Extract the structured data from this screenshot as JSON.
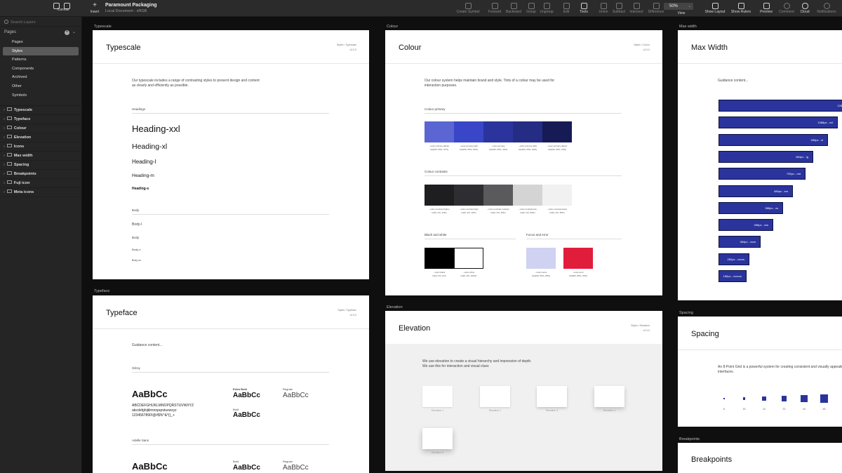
{
  "toolbar": {
    "canvas_label": "Canvas",
    "insert_label": "Insert",
    "doc_title": "Paramount Packaging",
    "doc_subtitle": "Local Document - sRGB",
    "create_symbol": "Create Symbol",
    "forward": "Forward",
    "backward": "Backward",
    "group": "Group",
    "ungroup": "Ungroup",
    "edit": "Edit",
    "tools": "Tools",
    "union": "Union",
    "subtract": "Subtract",
    "intersect": "Intersect",
    "difference": "Difference",
    "zoom_value": "50%",
    "view": "View",
    "show_layout": "Show Layout",
    "show_rulers": "Show Rulers",
    "preview": "Preview",
    "comment": "Comment",
    "cloud": "Cloud",
    "notifications": "Notifications"
  },
  "sidebar": {
    "search_placeholder": "Search Layers",
    "pages_header": "Pages",
    "pages": [
      "Pages",
      "Styles",
      "Patterns",
      "Components",
      "Archived",
      "Other",
      "Symbols"
    ],
    "selected_page": "Styles",
    "layers": [
      "Typescale",
      "Typeface",
      "Colour",
      "Elevation",
      "Icons",
      "Max width",
      "Spacing",
      "Breakpoints",
      "Fuji icon",
      "Meta icons"
    ]
  },
  "canvas": {
    "typescale": {
      "label": "Typescale",
      "title": "Typescale",
      "meta1": "Styles / Typescale",
      "meta2": "v2.0.0",
      "intro": "Our typescale includes a range of contrasting styles to present design and content as clearly and efficiently as possible.",
      "headings_label": "Headings",
      "headings": [
        "Heading-xxl",
        "Heading-xl",
        "Heading-l",
        "Heading-m",
        "Heading-s"
      ],
      "body_label": "Body",
      "body": [
        "Body-l",
        "Body",
        "Body-s",
        "Body-xs"
      ]
    },
    "typeface": {
      "label": "Typeface",
      "title": "Typeface",
      "meta1": "Styles / Typeface",
      "meta2": "v2.0.0",
      "guidance": "Guidance content...",
      "font1": "Gilroy",
      "sample": "AaBbCc",
      "alpha_upper": "ABCDEFGHIJKLMNOPQRSTUVWXYZ",
      "alpha_lower": "abcdefghijklmnopqrstuvwxyz",
      "alpha_nums": "1234567890!@#$%^&*()_+",
      "w_extra_bold": "Extra Bold",
      "w_regular": "Regular",
      "w_bold": "Bold",
      "font2": "Adelle Sans",
      "w_bold2": "Bold",
      "w_regular2": "Regular"
    },
    "colour": {
      "label": "Colour",
      "title": "Colour",
      "meta1": "Styles / Colour",
      "meta2": "v2.0.0",
      "intro": "Our colour system helps maintain brand and style. Tints of a colour may be used for interaction purposes.",
      "primary_label": "Colour primary",
      "primary": [
        {
          "name": "--color-primary-lighter",
          "value": "hsl(236, 55%, 57%)",
          "hex": "#5b66d2"
        },
        {
          "name": "--color-primary-light",
          "value": "hsl(236, 55%, 52%)",
          "hex": "#3a46c8"
        },
        {
          "name": "--color-primary",
          "value": "hsl(236, 55%, 43%)",
          "hex": "#2a349c"
        },
        {
          "name": "--color-primary-dark",
          "value": "hsl(236, 55%, 40%)",
          "hex": "#242c84"
        },
        {
          "name": "--color-primary-darker",
          "value": "hsl(236, 55%, 25%)",
          "hex": "#161b55"
        }
      ],
      "contrast_label": "Colour contrasts",
      "contrast": [
        {
          "name": "--color-contrast-higher",
          "value": "hsl(0, 0%, 13%)",
          "hex": "#1e1e21"
        },
        {
          "name": "--color-contrast-high",
          "value": "hsl(0, 0%, 20%)",
          "hex": "#2e2e32"
        },
        {
          "name": "--color-contrast-medium",
          "value": "hsl(0, 0%, 35%)",
          "hex": "#5a5a5c"
        },
        {
          "name": "--color-contrast-low",
          "value": "hsl(0, 0%, 83%)",
          "hex": "#d4d4d4"
        },
        {
          "name": "--color-contrast-lower",
          "value": "hsl(0, 0%, 95%)",
          "hex": "#f1f1f1"
        }
      ],
      "bw_label": "Black and white",
      "bw": [
        {
          "name": "--color-black",
          "value": "hsl(0, 0%, 0%)",
          "hex": "#000000"
        },
        {
          "name": "--color-white",
          "value": "hsl(0, 0%, 100%)",
          "hex": "#ffffff"
        }
      ],
      "focus_label": "Focus and error",
      "focus": [
        {
          "name": "--color-focus",
          "value": "hsl(236, 55%, 85%)",
          "hex": "#cfd2f1"
        },
        {
          "name": "--color-error",
          "value": "hsl(350, 85%, 50%)",
          "hex": "#e11d3c"
        }
      ]
    },
    "maxwidth": {
      "label": "Max width",
      "title": "Max Width",
      "guidance": "Guidance content...",
      "bars": [
        "1280px - xxxl",
        "1088px - xxl",
        "996px - xl",
        "864px - lg",
        "792px - md",
        "680px - sm",
        "588px - xs",
        "496px - xxs",
        "384px - xxxs",
        "282px - xxxxs",
        "180px - xxxxxs"
      ]
    },
    "elevation": {
      "label": "Elevation",
      "title": "Elevation",
      "meta1": "Styles / Elevation",
      "meta2": "v2.0.0",
      "intro1": "We use elevation to create a visual hierarchy and impression of depth.",
      "intro2": "We use this for interaction and visual clues",
      "cards": [
        "Elevation 1",
        "Elevation 2",
        "Elevation 3",
        "Elevation 4",
        "Elevation 5"
      ]
    },
    "spacing": {
      "label": "Spacing",
      "title": "Spacing",
      "intro": "An 8-Point Grid is a powerful system for creating consistent and visually appealing interfaces.",
      "squares": [
        "8",
        "16",
        "24",
        "32",
        "40",
        "48"
      ]
    },
    "breakpoints": {
      "label": "Breakpoints",
      "title": "Breakpoints"
    }
  }
}
